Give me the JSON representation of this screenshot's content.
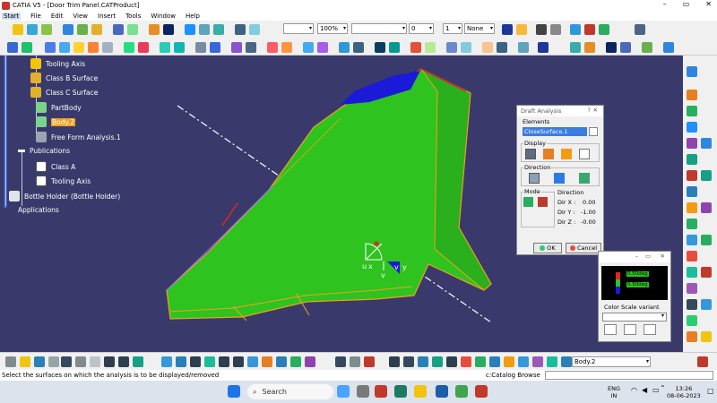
{
  "window": {
    "title": "CATIA V5 - [Door Trim Panel.CATProduct]",
    "minimize": "–",
    "restore": "▭",
    "close": "✕"
  },
  "menu": [
    "Start",
    "File",
    "Edit",
    "View",
    "Insert",
    "Tools",
    "Window",
    "Help"
  ],
  "toolbar": {
    "zoom_value": "100%",
    "thickness_value": "0",
    "layer_value": "1",
    "style_value": "None"
  },
  "tree": {
    "nodes": [
      {
        "label": "Tooling Axis"
      },
      {
        "label": "Class B Surface"
      },
      {
        "label": "Class C Surface"
      },
      {
        "label": "PartBody"
      },
      {
        "label": "Body.2"
      },
      {
        "label": "Free Form Analysis.1"
      },
      {
        "label": "Publications"
      },
      {
        "label": "Class A"
      },
      {
        "label": "Tooling Axis"
      },
      {
        "label": "Bottle Holder (Bottle Holder)"
      },
      {
        "label": "Applications"
      }
    ]
  },
  "compass": {
    "u": "u",
    "x": "x",
    "v": "v",
    "y": "y",
    "v2": "v"
  },
  "draft_dialog": {
    "title": "Draft Analysis",
    "help": "?",
    "close": "✕",
    "elements_label": "Elements",
    "elements_value": "CloseSurface.1",
    "display_label": "Display",
    "direction_label": "Direction",
    "mode_label": "Mode",
    "direction2_label": "Direction",
    "dir_x_label": "Dir X :",
    "dir_x_value": "0.00",
    "dir_y_label": "Dir Y :",
    "dir_y_value": "-1.00",
    "dir_z_label": "Dir Z :",
    "dir_z_value": "-0.00",
    "ok": "OK",
    "cancel": "Cancel"
  },
  "color_scale": {
    "title": "",
    "close": "✕",
    "minimize": "–",
    "restore": "▭",
    "value_hi": "0.50deg",
    "value_lo": "0.50deg",
    "variant_label": "Color Scale variant"
  },
  "bottom_toolbar": {
    "body_select": "Body.2"
  },
  "status": {
    "message": "Select the surfaces on which the analysis is to be displayed/removed",
    "catalog": "c:Catalog Browse"
  },
  "taskbar": {
    "search_placeholder": "Search",
    "lang": "ENG",
    "lang2": "IN",
    "time": "13:26",
    "date": "08-06-2023"
  },
  "colors": {
    "viewport": "#393a6b",
    "draft_green": "#2ec31f",
    "draft_blue": "#1a1ad8",
    "draft_red": "#e8231e"
  }
}
